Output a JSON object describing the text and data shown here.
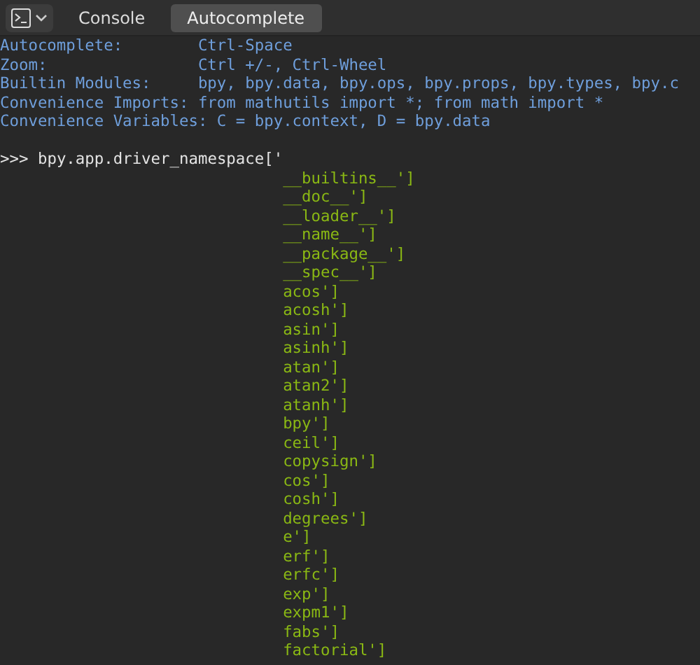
{
  "header": {
    "menus": [
      {
        "label": "Console",
        "selected": false
      },
      {
        "label": "Autocomplete",
        "selected": true
      }
    ]
  },
  "console": {
    "info_lines": [
      "Autocomplete:        Ctrl-Space",
      "Zoom:                Ctrl +/-, Ctrl-Wheel",
      "Builtin Modules:     bpy, bpy.data, bpy.ops, bpy.props, bpy.types, bpy.c",
      "Convenience Imports: from mathutils import *; from math import *",
      "Convenience Variables: C = bpy.context, D = bpy.data"
    ],
    "prompt": ">>>",
    "input": "bpy.app.driver_namespace['",
    "completions": [
      "__builtins__']",
      "__doc__']",
      "__loader__']",
      "__name__']",
      "__package__']",
      "__spec__']",
      "acos']",
      "acosh']",
      "asin']",
      "asinh']",
      "atan']",
      "atan2']",
      "atanh']",
      "bpy']",
      "ceil']",
      "copysign']",
      "cos']",
      "cosh']",
      "degrees']",
      "e']",
      "erf']",
      "erfc']",
      "exp']",
      "expm1']",
      "fabs']",
      "factorial']"
    ]
  }
}
